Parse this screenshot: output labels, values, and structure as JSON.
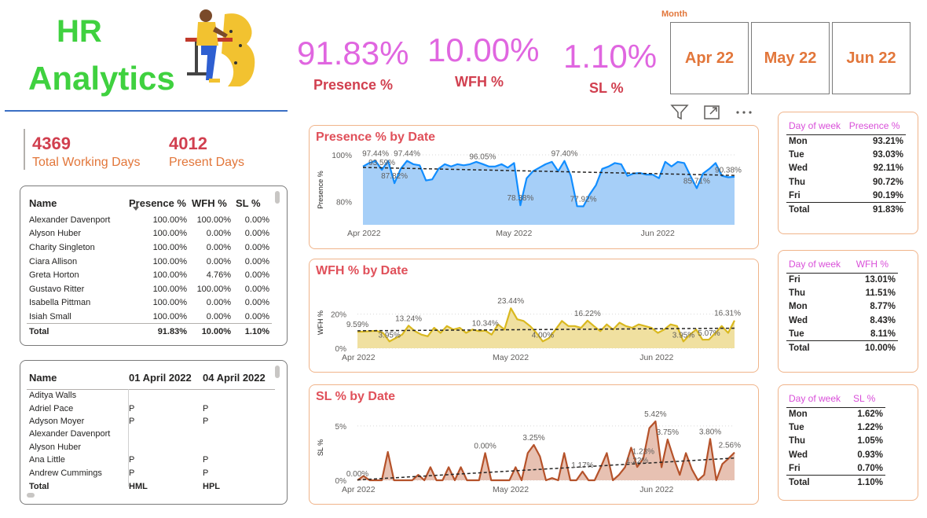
{
  "brand": {
    "line1": "HR",
    "line2": "Analytics"
  },
  "kpis": [
    {
      "value": "91.83%",
      "label": "Presence %"
    },
    {
      "value": "10.00%",
      "label": "WFH %"
    },
    {
      "value": "1.10%",
      "label": "SL %"
    }
  ],
  "month_slicer": {
    "title": "Month",
    "options": [
      "Apr 22",
      "May 22",
      "Jun 22"
    ]
  },
  "toolbar": {
    "filter_icon": "filter-icon",
    "focus_icon": "focus-mode-icon",
    "more_icon": "more-options-icon"
  },
  "cards": [
    {
      "value": "4369",
      "label": "Total Working Days"
    },
    {
      "value": "4012",
      "label": "Present Days"
    }
  ],
  "employee_table": {
    "headers": [
      "Name",
      "Presence %",
      "WFH %",
      "SL %"
    ],
    "rows": [
      [
        "Alexander Davenport",
        "100.00%",
        "100.00%",
        "0.00%"
      ],
      [
        "Alyson Huber",
        "100.00%",
        "0.00%",
        "0.00%"
      ],
      [
        "Charity Singleton",
        "100.00%",
        "0.00%",
        "0.00%"
      ],
      [
        "Ciara Allison",
        "100.00%",
        "0.00%",
        "0.00%"
      ],
      [
        "Greta Horton",
        "100.00%",
        "4.76%",
        "0.00%"
      ],
      [
        "Gustavo Ritter",
        "100.00%",
        "100.00%",
        "0.00%"
      ],
      [
        "Isabella Pittman",
        "100.00%",
        "0.00%",
        "0.00%"
      ],
      [
        "Isiah Small",
        "100.00%",
        "0.00%",
        "0.00%"
      ]
    ],
    "total": [
      "Total",
      "91.83%",
      "10.00%",
      "1.10%"
    ]
  },
  "attendance_table": {
    "headers": [
      "Name",
      "01 April 2022",
      "04 April 2022"
    ],
    "rows": [
      [
        "Aditya Walls",
        "",
        ""
      ],
      [
        "Adriel Pace",
        "P",
        "P"
      ],
      [
        "Adyson Moyer",
        "P",
        "P"
      ],
      [
        "Alexander Davenport",
        "",
        ""
      ],
      [
        "Alyson Huber",
        "",
        ""
      ],
      [
        "Ana Little",
        "P",
        "P"
      ],
      [
        "Andrew Cummings",
        "P",
        "P"
      ]
    ],
    "total": [
      "Total",
      "HML",
      "HPL"
    ]
  },
  "chart_data": [
    {
      "type": "area",
      "title": "Presence % by Date",
      "ylabel": "Presence %",
      "yticks": [
        "80%",
        "100%"
      ],
      "ylim": [
        70,
        100
      ],
      "xticks": [
        "Apr 2022",
        "May 2022",
        "Jun 2022"
      ],
      "trendline": true,
      "color": "#118dff",
      "fill": "#a6cff8",
      "values": [
        95,
        96.5,
        97.4,
        93.59,
        97.4,
        87.82,
        94,
        97.44,
        96,
        95.5,
        89,
        89.5,
        94,
        96,
        95,
        96,
        95.5,
        96,
        97,
        96.05,
        95,
        95,
        96,
        94.5,
        96.5,
        78.38,
        90,
        93,
        94.5,
        96,
        97,
        93,
        97.4,
        91,
        78,
        77.92,
        83,
        87,
        94,
        95,
        96.5,
        96,
        91,
        92,
        92.2,
        91.5,
        91.5,
        90,
        97,
        95,
        97,
        96.5,
        91,
        85.71,
        92,
        94,
        96.5,
        91,
        90.38,
        90.6
      ],
      "data_labels": [
        {
          "i": 2,
          "text": "97.44%"
        },
        {
          "i": 3,
          "text": "93.59%"
        },
        {
          "i": 5,
          "text": "87.82%"
        },
        {
          "i": 7,
          "text": "97.44%"
        },
        {
          "i": 19,
          "text": "96.05%"
        },
        {
          "i": 25,
          "text": "78.38%"
        },
        {
          "i": 32,
          "text": "97.40%"
        },
        {
          "i": 35,
          "text": "77.92%"
        },
        {
          "i": 53,
          "text": "85.71%"
        },
        {
          "i": 58,
          "text": "90.38%"
        }
      ]
    },
    {
      "type": "area",
      "title": "WFH % by Date",
      "ylabel": "WFH %",
      "yticks": [
        "0%",
        "20%"
      ],
      "ylim": [
        0,
        30
      ],
      "xticks": [
        "Apr 2022",
        "May 2022",
        "Jun 2022"
      ],
      "trendline": true,
      "color": "#d9b81f",
      "fill": "#f0e0a0",
      "values": [
        9.59,
        9.8,
        10,
        10.2,
        9,
        3.95,
        6,
        8,
        13.24,
        10,
        8,
        7,
        12,
        9,
        13,
        11,
        12,
        9,
        11,
        10,
        10.34,
        8,
        14,
        11,
        23.44,
        17,
        16,
        13,
        9,
        4,
        6,
        11,
        16,
        13,
        13,
        12,
        16.22,
        13,
        10,
        14,
        11,
        15,
        13,
        12,
        14,
        13,
        12,
        9,
        11,
        14,
        13,
        3.95,
        8,
        11,
        5,
        5.07,
        9,
        13,
        9,
        16.31
      ],
      "data_labels": [
        {
          "i": 0,
          "text": "9.59%"
        },
        {
          "i": 5,
          "text": "3.95%"
        },
        {
          "i": 8,
          "text": "13.24%"
        },
        {
          "i": 20,
          "text": "10.34%"
        },
        {
          "i": 24,
          "text": "23.44%"
        },
        {
          "i": 29,
          "text": "4.00%"
        },
        {
          "i": 36,
          "text": "16.22%"
        },
        {
          "i": 51,
          "text": "3.95%"
        },
        {
          "i": 55,
          "text": "5.07%"
        },
        {
          "i": 59,
          "text": "16.31%"
        }
      ]
    },
    {
      "type": "area",
      "title": "SL % by Date",
      "ylabel": "SL %",
      "yticks": [
        "0%",
        "5%"
      ],
      "ylim": [
        0,
        6
      ],
      "xticks": [
        "Apr 2022",
        "May 2022",
        "Jun 2022"
      ],
      "trendline": true,
      "color": "#b5522a",
      "fill": "#e7c1b2",
      "values": [
        0,
        0.4,
        0,
        0,
        0,
        2.6,
        0,
        0,
        0,
        0,
        0.5,
        0,
        1.2,
        0,
        0,
        1.2,
        0,
        1.2,
        0,
        0,
        0,
        2.5,
        0,
        0,
        0,
        0,
        1.2,
        0,
        2.5,
        3.25,
        2.2,
        0,
        0.2,
        0,
        2.5,
        0,
        0,
        0.8,
        0,
        0,
        1.2,
        2.5,
        0,
        0.5,
        1.2,
        3,
        1.22,
        2,
        4.8,
        5.42,
        1.2,
        3.75,
        2,
        0.5,
        2.5,
        1,
        0,
        0.5,
        3.8,
        0,
        1.5,
        2,
        2.56
      ],
      "data_labels": [
        {
          "i": 0,
          "text": "0.00%"
        },
        {
          "i": 21,
          "text": "0.00%"
        },
        {
          "i": 29,
          "text": "3.25%"
        },
        {
          "i": 37,
          "text": "1.17%"
        },
        {
          "i": 46,
          "text": "1.22%"
        },
        {
          "i": 47,
          "text": "1.23%"
        },
        {
          "i": 49,
          "text": "5.42%"
        },
        {
          "i": 51,
          "text": "3.75%"
        },
        {
          "i": 58,
          "text": "3.80%"
        },
        {
          "i": 62,
          "text": "2.56%"
        }
      ]
    }
  ],
  "dow_presence": {
    "headers": [
      "Day of week",
      "Presence %"
    ],
    "rows": [
      [
        "Mon",
        "93.21%"
      ],
      [
        "Tue",
        "93.03%"
      ],
      [
        "Wed",
        "92.11%"
      ],
      [
        "Thu",
        "90.72%"
      ],
      [
        "Fri",
        "90.19%"
      ]
    ],
    "total": [
      "Total",
      "91.83%"
    ]
  },
  "dow_wfh": {
    "headers": [
      "Day of week",
      "WFH %"
    ],
    "rows": [
      [
        "Fri",
        "13.01%"
      ],
      [
        "Thu",
        "11.51%"
      ],
      [
        "Mon",
        "8.77%"
      ],
      [
        "Wed",
        "8.43%"
      ],
      [
        "Tue",
        "8.11%"
      ]
    ],
    "total": [
      "Total",
      "10.00%"
    ]
  },
  "dow_sl": {
    "headers": [
      "Day of week",
      "SL %"
    ],
    "rows": [
      [
        "Mon",
        "1.62%"
      ],
      [
        "Tue",
        "1.22%"
      ],
      [
        "Thu",
        "1.05%"
      ],
      [
        "Wed",
        "0.93%"
      ],
      [
        "Fri",
        "0.70%"
      ]
    ],
    "total": [
      "Total",
      "1.10%"
    ]
  }
}
